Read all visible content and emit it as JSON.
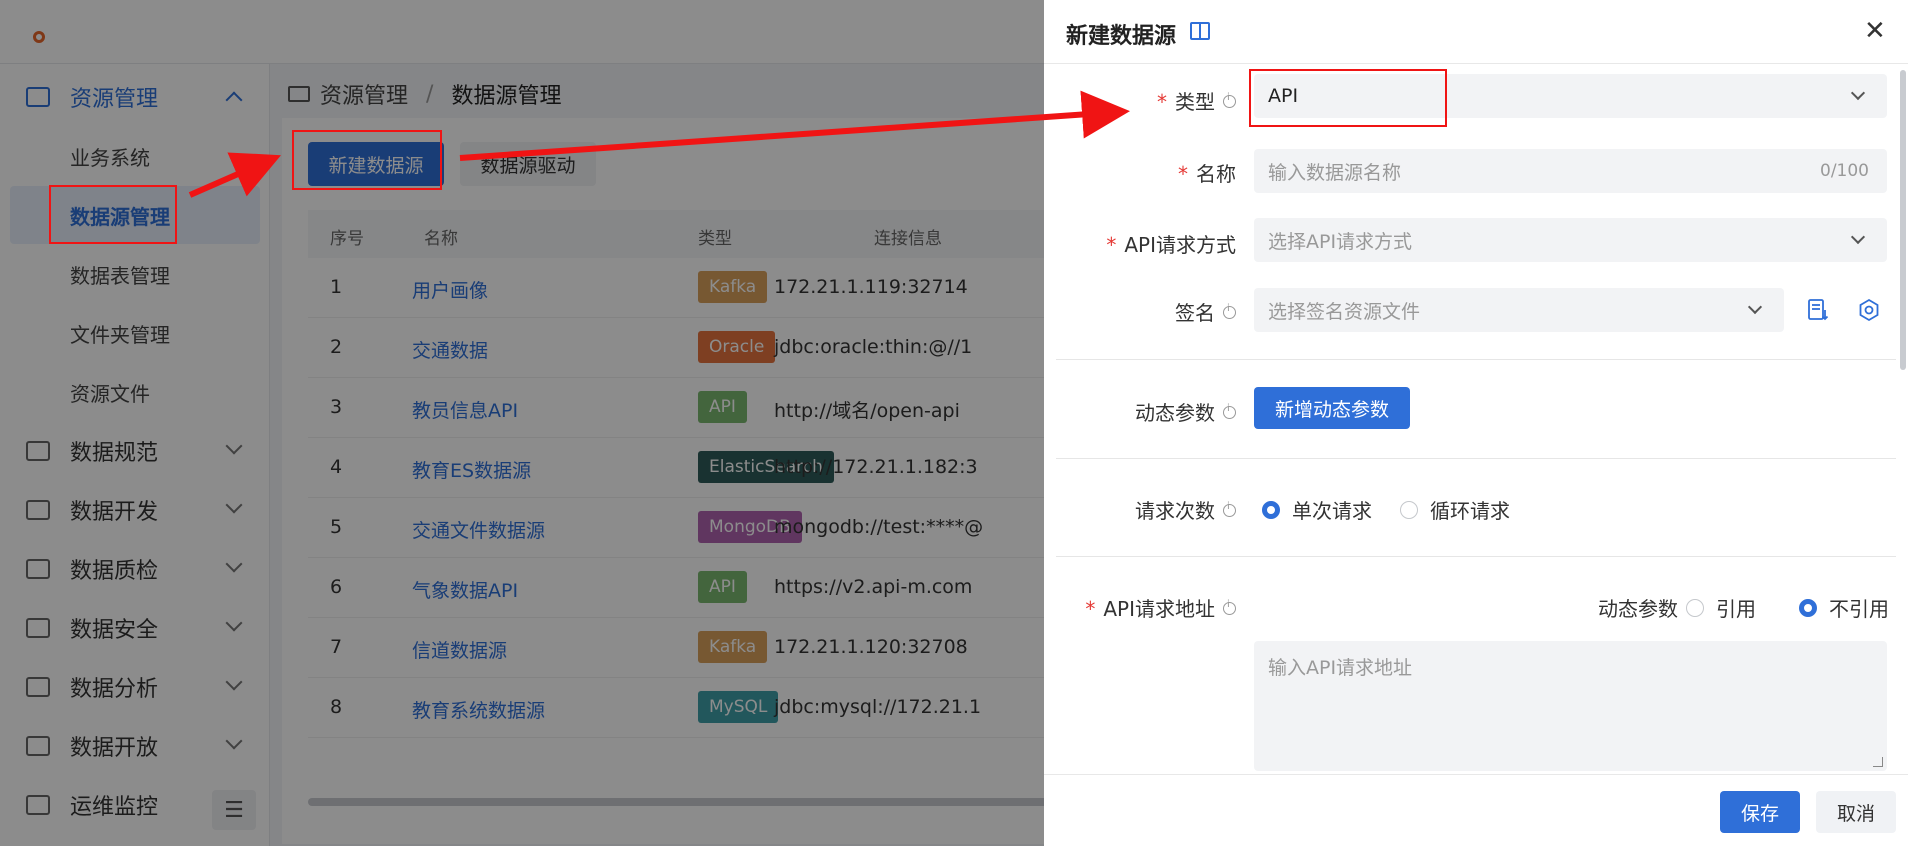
{
  "sidebar": {
    "groups": [
      {
        "label": "资源管理",
        "icon": "keyboard-icon"
      },
      {
        "label": "数据规范",
        "icon": "monitor-icon"
      },
      {
        "label": "数据开发",
        "icon": "code-icon"
      },
      {
        "label": "数据质检",
        "icon": "checklist-icon"
      },
      {
        "label": "数据安全",
        "icon": "shield-icon"
      },
      {
        "label": "数据分析",
        "icon": "analytics-icon"
      },
      {
        "label": "数据开放",
        "icon": "share-icon"
      },
      {
        "label": "运维监控",
        "icon": "line-chart-icon"
      }
    ],
    "sub_items": [
      {
        "label": "业务系统"
      },
      {
        "label": "数据源管理"
      },
      {
        "label": "数据表管理"
      },
      {
        "label": "文件夹管理"
      },
      {
        "label": "资源文件"
      }
    ],
    "collapse_icon": "collapse-menu-icon"
  },
  "breadcrumb": {
    "root": "资源管理",
    "separator": "/",
    "current": "数据源管理"
  },
  "toolbar": {
    "new_datasource": "新建数据源",
    "driver": "数据源驱动"
  },
  "table": {
    "columns": [
      "序号",
      "名称",
      "类型",
      "连接信息"
    ],
    "rows": [
      {
        "no": "1",
        "name": "用户画像",
        "type": "Kafka",
        "type_color": "#d9a05b",
        "conn": "172.21.1.119:32714"
      },
      {
        "no": "2",
        "name": "交通数据",
        "type": "Oracle",
        "type_color": "#e5743f",
        "conn": "jdbc:oracle:thin:@//1"
      },
      {
        "no": "3",
        "name": "教员信息API",
        "type": "API",
        "type_color": "#7bb86f",
        "conn": "http://域名/open-api"
      },
      {
        "no": "4",
        "name": "教育ES数据源",
        "type": "ElasticSearch",
        "type_color": "#2f5c5a",
        "conn": "http://172.21.1.182:3"
      },
      {
        "no": "5",
        "name": "交通文件数据源",
        "type": "MongoDB",
        "type_color": "#b063b0",
        "conn": "mongodb://test:****@"
      },
      {
        "no": "6",
        "name": "气象数据API",
        "type": "API",
        "type_color": "#7bb86f",
        "conn": "https://v2.api-m.com"
      },
      {
        "no": "7",
        "name": "信道数据源",
        "type": "Kafka",
        "type_color": "#d9a05b",
        "conn": "172.21.1.120:32708"
      },
      {
        "no": "8",
        "name": "教育系统数据源",
        "type": "MySQL",
        "type_color": "#3f9fa8",
        "conn": "jdbc:mysql://172.21.1"
      }
    ]
  },
  "drawer": {
    "title": "新建数据源",
    "fields": {
      "type_label": "类型",
      "type_value": "API",
      "name_label": "名称",
      "name_placeholder": "输入数据源名称",
      "name_count": "0/100",
      "method_label": "API请求方式",
      "method_placeholder": "选择API请求方式",
      "sign_label": "签名",
      "sign_placeholder": "选择签名资源文件",
      "dynamic_label": "动态参数",
      "dynamic_button": "新增动态参数",
      "req_count_label": "请求次数",
      "req_single": "单次请求",
      "req_loop": "循环请求",
      "url_label": "API请求地址",
      "url_dynamic_label": "动态参数",
      "url_ref": "引用",
      "url_noref": "不引用",
      "url_placeholder": "输入API请求地址"
    },
    "footer": {
      "save": "保存",
      "cancel": "取消"
    }
  }
}
